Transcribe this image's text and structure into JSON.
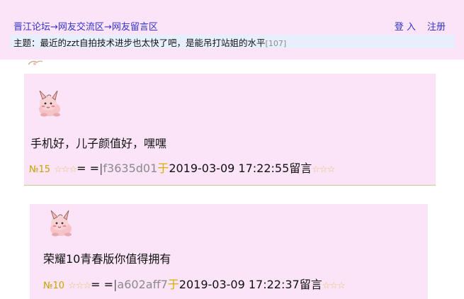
{
  "header": {
    "breadcrumb": {
      "forum": "晋江论坛",
      "arrow1": "→",
      "area": "网友交流区",
      "arrow2": "→",
      "board": "网友留言区"
    },
    "auth": {
      "login": "登 入",
      "register": "注册"
    },
    "subject_label": "主题：",
    "subject_title": "最近的zzt自拍技术进步也太快了吧，是能吊打站姐的水平",
    "subject_count": "[107]"
  },
  "posts": [
    {
      "content": "手机好，儿子颜值好，嘿嘿",
      "number": "№15",
      "stars": "☆☆☆",
      "eq": "= =",
      "bar": "|",
      "user_id": "f3635d01",
      "yu": "于",
      "datetime": "2019-03-09 17:22:55",
      "liuyan": "留言",
      "stars_after": "☆☆☆"
    },
    {
      "content": "荣耀10青春版你值得拥有",
      "number": "№10",
      "stars": "☆☆☆",
      "eq": "= =",
      "bar": "|",
      "user_id": "a602aff7",
      "yu": "于",
      "datetime": "2019-03-09 17:22:37",
      "liuyan": "留言",
      "stars_after": "☆☆☆"
    }
  ],
  "icons": {
    "avatar": "clefairy-avatar-icon"
  },
  "colors": {
    "post_bg": "#fbe4f7",
    "subject_bg": "#e7eefc",
    "link": "#3333cc",
    "accent_gold": "#d4b300"
  }
}
